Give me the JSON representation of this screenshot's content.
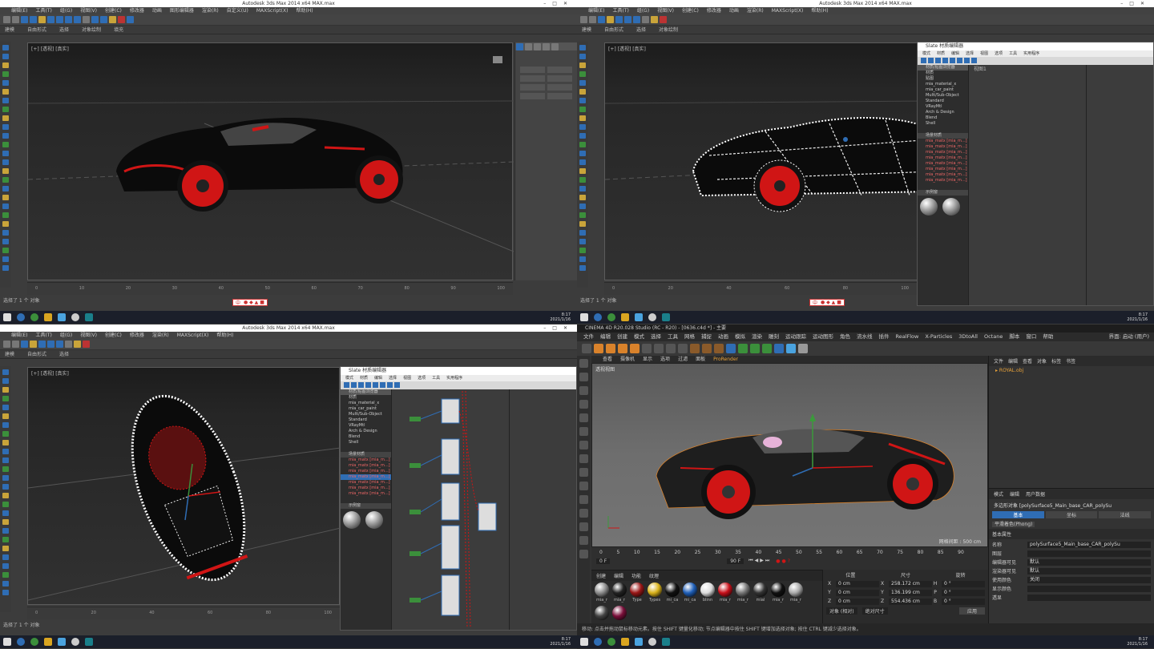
{
  "max_title": "Autodesk 3ds Max 2014 x64    MAX.max",
  "max_menu": [
    "编辑(E)",
    "工具(T)",
    "组(G)",
    "视图(V)",
    "创建(C)",
    "修改器",
    "动画",
    "图形编辑器",
    "渲染(R)",
    "自定义(U)",
    "MAXScript(X)",
    "帮助(H)"
  ],
  "max_ribbon": [
    "建模",
    "自由形式",
    "选择",
    "对象绘制",
    "填充"
  ],
  "max_viewport_label": "[+] [透视] [真实]",
  "max_statusbar": "选择了 1 个 对象",
  "max_timeline_pos": "0 / 100",
  "max_timeline_ticks": [
    "0",
    "10",
    "20",
    "30",
    "40",
    "50",
    "60",
    "70",
    "80",
    "90",
    "100"
  ],
  "ime_label": "中",
  "slate_title": "Slate 材质编辑器",
  "slate_menu": [
    "模式",
    "材质",
    "编辑",
    "选择",
    "视图",
    "选项",
    "工具",
    "实用程序"
  ],
  "slate_browser_header": "材质/贴图浏览器",
  "slate_items": [
    "材质",
    "贴图",
    "场景材质",
    "示例窗",
    "mia_material_x",
    "mia_car_paint",
    "Multi/Sub-Object",
    "Standard",
    "VRayMtl",
    "Arch & Design",
    "Blend",
    "Shell"
  ],
  "slate_scene": [
    "mia_matx [mia_m...]",
    "mia_matx [mia_m...]",
    "mia_matx [mia_m...]",
    "mia_matx [mia_m...]",
    "mia_matx [mia_m...]",
    "mia_matx [mia_m...]",
    "mia_matx [mia_m...]",
    "mia_matx [mia_m...]"
  ],
  "slate_view_label": "视图1",
  "c4d_title": "CINEMA 4D R20.028 Studio (RC - R20) - [0636.c4d *] - 主要",
  "c4d_menu": [
    "文件",
    "编辑",
    "创建",
    "模式",
    "选择",
    "工具",
    "网格",
    "捕捉",
    "动画",
    "模拟",
    "渲染",
    "雕刻",
    "运动跟踪",
    "运动图形",
    "角色",
    "流水线",
    "插件",
    "RealFlow",
    "X-Particles",
    "3DtoAll",
    "Octane",
    "脚本",
    "窗口",
    "帮助"
  ],
  "c4d_layout": "界面: 启动 (用户)",
  "c4d_viewport_menu": [
    "查看",
    "摄像机",
    "显示",
    "选项",
    "过滤",
    "面板",
    "ProRender"
  ],
  "c4d_viewport_label": "透视视图",
  "c4d_grid": "网格间距 : 500 cm",
  "c4d_timeline_ticks": [
    "0",
    "5",
    "10",
    "15",
    "20",
    "25",
    "30",
    "35",
    "40",
    "45",
    "50",
    "55",
    "60",
    "65",
    "70",
    "75",
    "80",
    "85",
    "90"
  ],
  "c4d_frame_start": "0 F",
  "c4d_frame_end": "90 F",
  "c4d_frame_cur": "0 F",
  "c4d_mat_menu": [
    "创建",
    "编辑",
    "功能",
    "纹理"
  ],
  "c4d_materials": [
    {
      "name": "mia_r",
      "color": "#8c8c8c"
    },
    {
      "name": "mia_r",
      "color": "#222"
    },
    {
      "name": "Type",
      "color": "#9a1616"
    },
    {
      "name": "Types",
      "color": "#d9b21a"
    },
    {
      "name": "mi_ca",
      "color": "#111"
    },
    {
      "name": "mi_ca",
      "color": "#1f5fb8"
    },
    {
      "name": "blinn",
      "color": "#ddd"
    },
    {
      "name": "mia_r",
      "color": "#c8101a"
    },
    {
      "name": "mia_r",
      "color": "#777"
    },
    {
      "name": "mial",
      "color": "#333"
    },
    {
      "name": "mia_r",
      "color": "#111"
    },
    {
      "name": "mia_r",
      "color": "#aaa"
    },
    {
      "name": "",
      "color": "#444"
    },
    {
      "name": "",
      "color": "#7a0f3a"
    }
  ],
  "c4d_coord_headers": [
    "位置",
    "尺寸",
    "旋转"
  ],
  "c4d_coord_rows": [
    {
      "axis": "X",
      "pos": "0 cm",
      "size": "258.172 cm",
      "rotl": "H",
      "rot": "0 °"
    },
    {
      "axis": "Y",
      "pos": "0 cm",
      "size": "136.199 cm",
      "rotl": "P",
      "rot": "0 °"
    },
    {
      "axis": "Z",
      "pos": "0 cm",
      "size": "554.436 cm",
      "rotl": "B",
      "rot": "0 °"
    }
  ],
  "c4d_coord_mode": "对象 (相对)",
  "c4d_size_mode": "绝对尺寸",
  "c4d_apply": "应用",
  "c4d_obj_menu": [
    "文件",
    "编辑",
    "查看",
    "对象",
    "标签",
    "书签"
  ],
  "c4d_obj_item": "ROYAL.obj",
  "c4d_attr_menu": [
    "模式",
    "编辑",
    "用户数据"
  ],
  "c4d_attr_title": "多边形对象 [polySurface5_Main_base_CAR_polySu",
  "c4d_attr_tabs": [
    "基本",
    "坐标",
    "法线"
  ],
  "c4d_attr_phong": "平滑着色(Phong)",
  "c4d_attr_section": "基本属性",
  "c4d_attr_fields": [
    {
      "label": "名称",
      "value": "polySurface5_Main_base_CAR_polySu"
    },
    {
      "label": "图层",
      "value": ""
    },
    {
      "label": "编辑器可见",
      "value": "默认"
    },
    {
      "label": "渲染器可见",
      "value": "默认"
    },
    {
      "label": "使用颜色",
      "value": "关闭"
    },
    {
      "label": "显示颜色",
      "value": ""
    },
    {
      "label": "透显",
      "value": ""
    }
  ],
  "c4d_status": "移动: 点击并拖动鼠标移动元素。按住 SHIFT 键量化移动; 节点编辑器中按住 SHIFT 键增加选择对象; 按住 CTRL 键减少选择对象。",
  "clock_time": "8:17",
  "clock_date": "2021/1/16",
  "colors": {
    "car_red": "#d01515",
    "accent_blue": "#2f6db4"
  }
}
